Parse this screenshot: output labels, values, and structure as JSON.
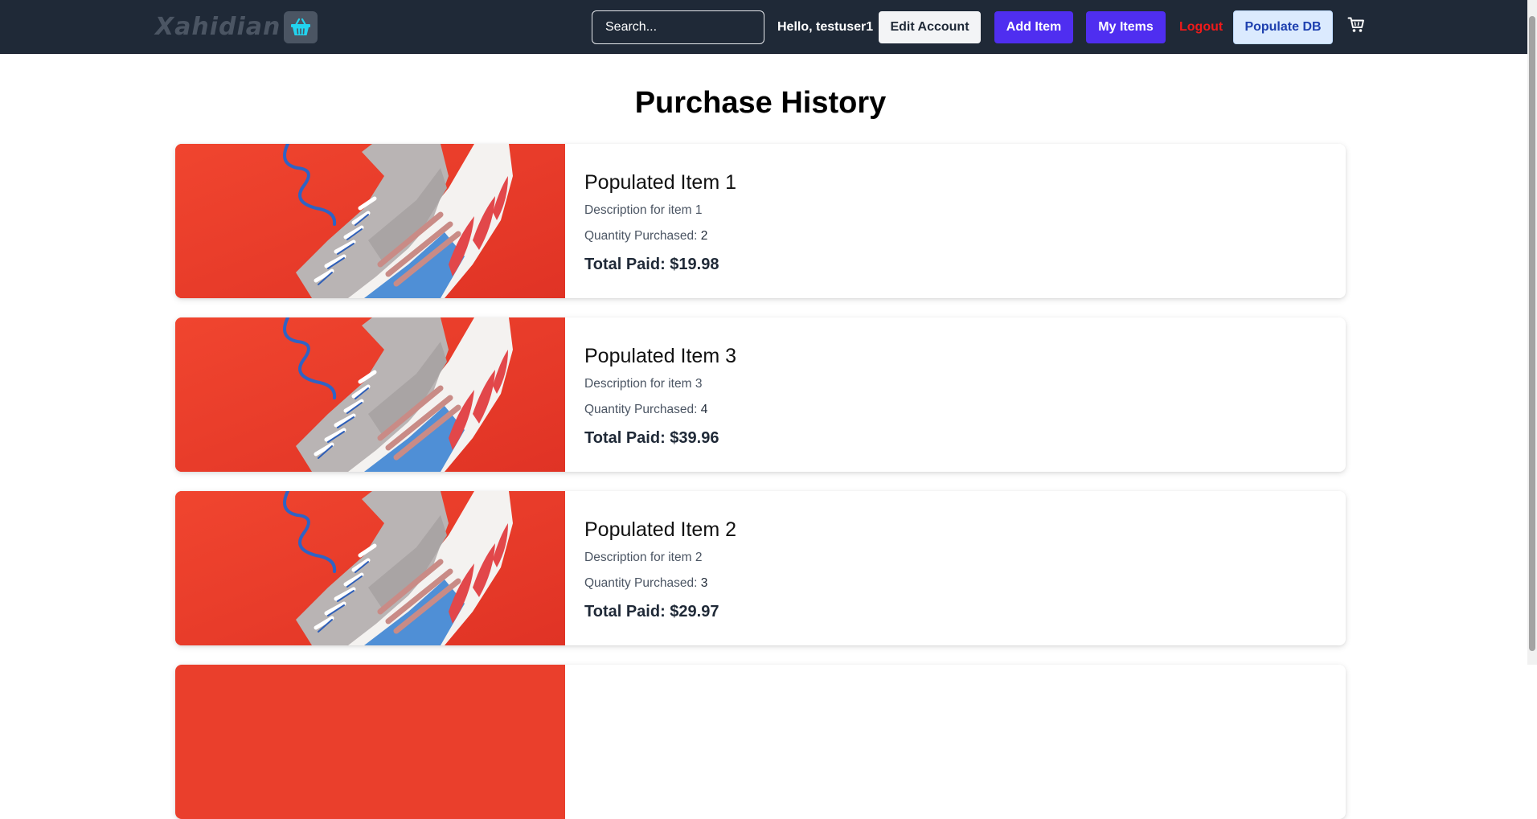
{
  "navbar": {
    "logo_text": "Xahidian",
    "search_placeholder": "Search...",
    "greeting": "Hello, testuser1",
    "edit_account_label": "Edit Account",
    "add_item_label": "Add Item",
    "my_items_label": "My Items",
    "logout_label": "Logout",
    "populate_db_label": "Populate DB"
  },
  "colors": {
    "navbar_bg": "#1f2937",
    "primary_button": "#4f2ef0",
    "logout": "#ef1a1a",
    "populate_bg": "#dbeafe",
    "product_bg": "#ea3f2c"
  },
  "page": {
    "title": "Purchase History"
  },
  "purchases": [
    {
      "name": "Populated Item 1",
      "description": "Description for item 1",
      "quantity_label": "Quantity Purchased: ",
      "quantity": "2",
      "total": "Total Paid: $19.98"
    },
    {
      "name": "Populated Item 3",
      "description": "Description for item 3",
      "quantity_label": "Quantity Purchased: ",
      "quantity": "4",
      "total": "Total Paid: $39.96"
    },
    {
      "name": "Populated Item 2",
      "description": "Description for item 2",
      "quantity_label": "Quantity Purchased: ",
      "quantity": "3",
      "total": "Total Paid: $29.97"
    }
  ]
}
